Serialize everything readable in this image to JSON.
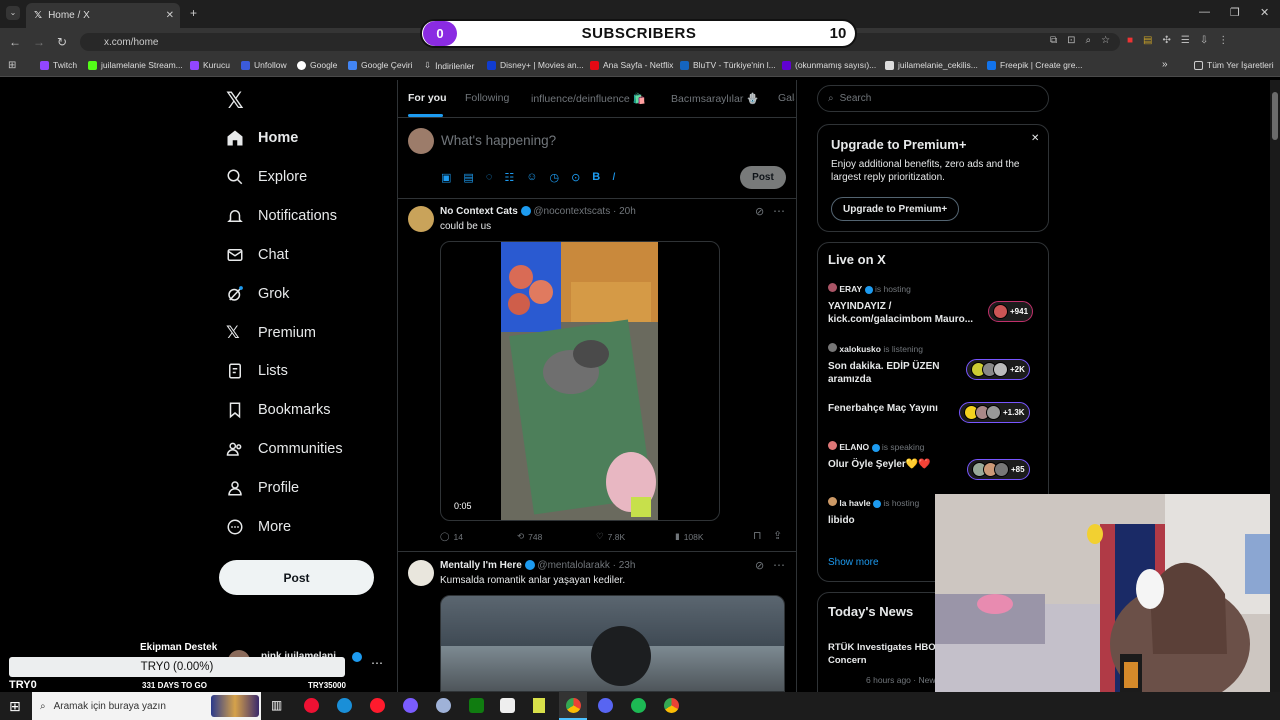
{
  "browser": {
    "tab_title": "Home / X",
    "url": "x.com/home",
    "bookmarks": [
      "Twitch",
      "juilamelanie Stream...",
      "Kurucu",
      "Unfollow",
      "Google",
      "Google Çeviri",
      "İndirilenler",
      "Disney+ | Movies an...",
      "Ana Sayfa - Netflix",
      "BluTV - Türkiye'nin l...",
      "(okunmamış sayısı)...",
      "juilamelanie_cekilis...",
      "Freepik | Create gre..."
    ],
    "all_bookmarks": "Tüm Yer İşaretleri"
  },
  "overlay": {
    "subscribers_label": "SUBSCRIBERS",
    "subscribers_start": "0",
    "subscribers_goal": "10",
    "donation_label": "Ekipman Destek",
    "donation_amount": "TRY0 (0.00%)",
    "donation_current": "TRY0",
    "days_left": "331 DAYS TO GO",
    "donation_target": "TRY35000"
  },
  "sidebar": {
    "items": [
      "Home",
      "Explore",
      "Notifications",
      "Chat",
      "Grok",
      "Premium",
      "Lists",
      "Bookmarks",
      "Communities",
      "Profile",
      "More"
    ],
    "post_button": "Post",
    "account_name": "pink juilamelani"
  },
  "main": {
    "tabs": [
      "For you",
      "Following",
      "influence/deinfluence 🛍️",
      "Bacımsaraylılar 🪬",
      "Gala"
    ],
    "compose_placeholder": "What's happening?",
    "compose_post_button": "Post",
    "tweets": [
      {
        "name": "No Context Cats",
        "handle": "@nocontextscats",
        "time": "20h",
        "text": "could be us",
        "video_time": "0:05",
        "replies": "14",
        "retweets": "748",
        "likes": "7.8K",
        "views": "108K"
      },
      {
        "name": "Mentally I'm Here",
        "handle": "@mentalolarakk",
        "time": "23h",
        "text": "Kumsalda romantik anlar yaşayan kediler."
      }
    ]
  },
  "right": {
    "search_placeholder": "Search",
    "premium": {
      "title": "Upgrade to Premium+",
      "body": "Enjoy additional benefits, zero ads and the largest reply prioritization.",
      "button": "Upgrade to Premium+"
    },
    "live": {
      "title": "Live on X",
      "items": [
        {
          "host": "ERAY",
          "status": "is hosting",
          "title": "YAYINDAYIZ / kick.com/galacimbom Mauro...",
          "count": "+941"
        },
        {
          "host": "xalokusko",
          "status": "is listening",
          "title": "Son dakika. EDİP ÜZEN aramızda",
          "count": "+2K"
        },
        {
          "host": "",
          "status": "",
          "title": "Fenerbahçe Maç Yayını",
          "count": "+1.3K"
        },
        {
          "host": "ELANO",
          "status": "is speaking",
          "title": "Olur Öyle Şeyler💛❤️",
          "count": "+85"
        },
        {
          "host": "la havle",
          "status": "is hosting",
          "title": "libido",
          "count": ""
        }
      ],
      "show_more": "Show more"
    },
    "news": {
      "title": "Today's News",
      "headline": "RTÜK Investigates HBO Family Values Concern",
      "meta": "6 hours ago · News"
    }
  },
  "taskbar": {
    "search_placeholder": "Aramak için buraya yazın"
  }
}
